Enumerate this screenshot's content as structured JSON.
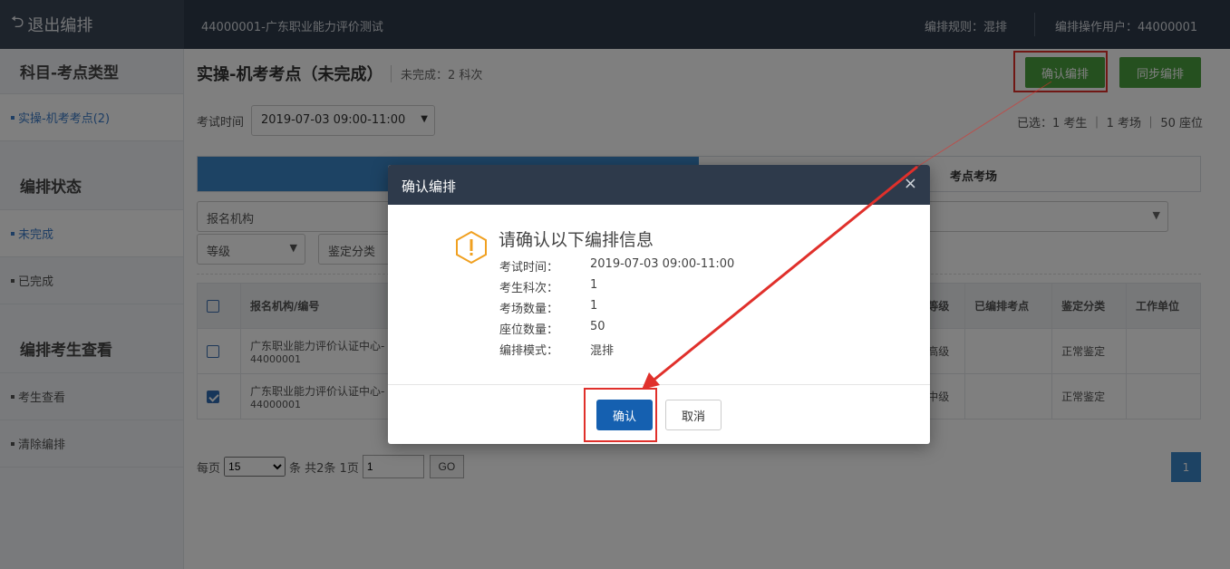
{
  "topbar": {
    "exit_label": "退出编排",
    "exam_title": "44000001-广东职业能力评价测试",
    "rule": "编排规则：混排",
    "operator": "编排操作用户：44000001"
  },
  "sidebar": {
    "section1": "科目-考点类型",
    "subject_item": "实操-机考考点(2)",
    "section2": "编排状态",
    "status_incomplete": "未完成",
    "status_complete": "已完成",
    "section3": "编排考生查看",
    "view_candidates": "考生查看",
    "clear_arrangement": "清除编排"
  },
  "main": {
    "title": "实操-机考考点（未完成）",
    "subtitle": "未完成：2 科次",
    "confirm_button": "确认编排",
    "sync_button": "同步编排",
    "exam_time_label": "考试时间",
    "exam_time_value": "2019-07-03 09:00-11:00",
    "summary": "已选：1 考生 ｜ 1 考场 ｜ 50 座位",
    "tab_b_label": "考点考场",
    "filter_org": "报名机构",
    "filter_level": "等级",
    "filter_category": "鉴定分类"
  },
  "table": {
    "headers": {
      "org": "报名机构/编号",
      "level": "等级",
      "assigned": "已编排考点",
      "category": "鉴定分类",
      "workplace": "工作单位"
    },
    "rows": [
      {
        "org": "广东职业能力评价认证中心-",
        "org_id": "44000001",
        "level": "高级",
        "category": "正常鉴定",
        "checked": false
      },
      {
        "org": "广东职业能力评价认证中心-",
        "org_id": "44000001",
        "level": "中级",
        "category": "正常鉴定",
        "checked": true
      }
    ]
  },
  "pager": {
    "per_page_label": "每页",
    "per_page_value": "15",
    "count_text": "条 共2条 1页",
    "page_input": "1",
    "go_label": "GO",
    "current_page": "1"
  },
  "modal": {
    "title": "确认编排",
    "close": "×",
    "heading": "请确认以下编排信息",
    "info": [
      {
        "k": "考试时间：",
        "v": "2019-07-03 09:00-11:00"
      },
      {
        "k": "考生科次：",
        "v": "1"
      },
      {
        "k": "考场数量：",
        "v": "1"
      },
      {
        "k": "座位数量：",
        "v": "50"
      },
      {
        "k": "编排模式：",
        "v": "混排"
      }
    ],
    "ok": "确认",
    "cancel": "取消"
  },
  "colors": {
    "topbar": "#2e3a4b",
    "green_button": "#4aa03f",
    "primary_blue": "#1560b0",
    "annotation_red": "#e0302b"
  }
}
